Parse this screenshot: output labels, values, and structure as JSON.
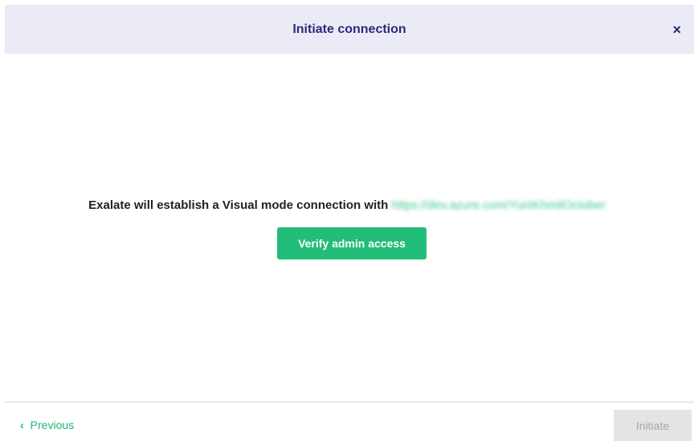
{
  "header": {
    "title": "Initiate connection",
    "close_label": "×"
  },
  "main": {
    "message": "Exalate will establish a Visual mode connection with",
    "url": "https://dev.azure.com/YuriiKhmilOctober",
    "verify_button": "Verify admin access"
  },
  "footer": {
    "previous_icon": "‹",
    "previous_label": "Previous",
    "initiate_button": "Initiate"
  },
  "colors": {
    "header_bg": "#ebebf5",
    "title_color": "#2d2a7a",
    "accent_green": "#22bd78",
    "link_green": "#22b573",
    "disabled_bg": "#e4e4e4"
  }
}
